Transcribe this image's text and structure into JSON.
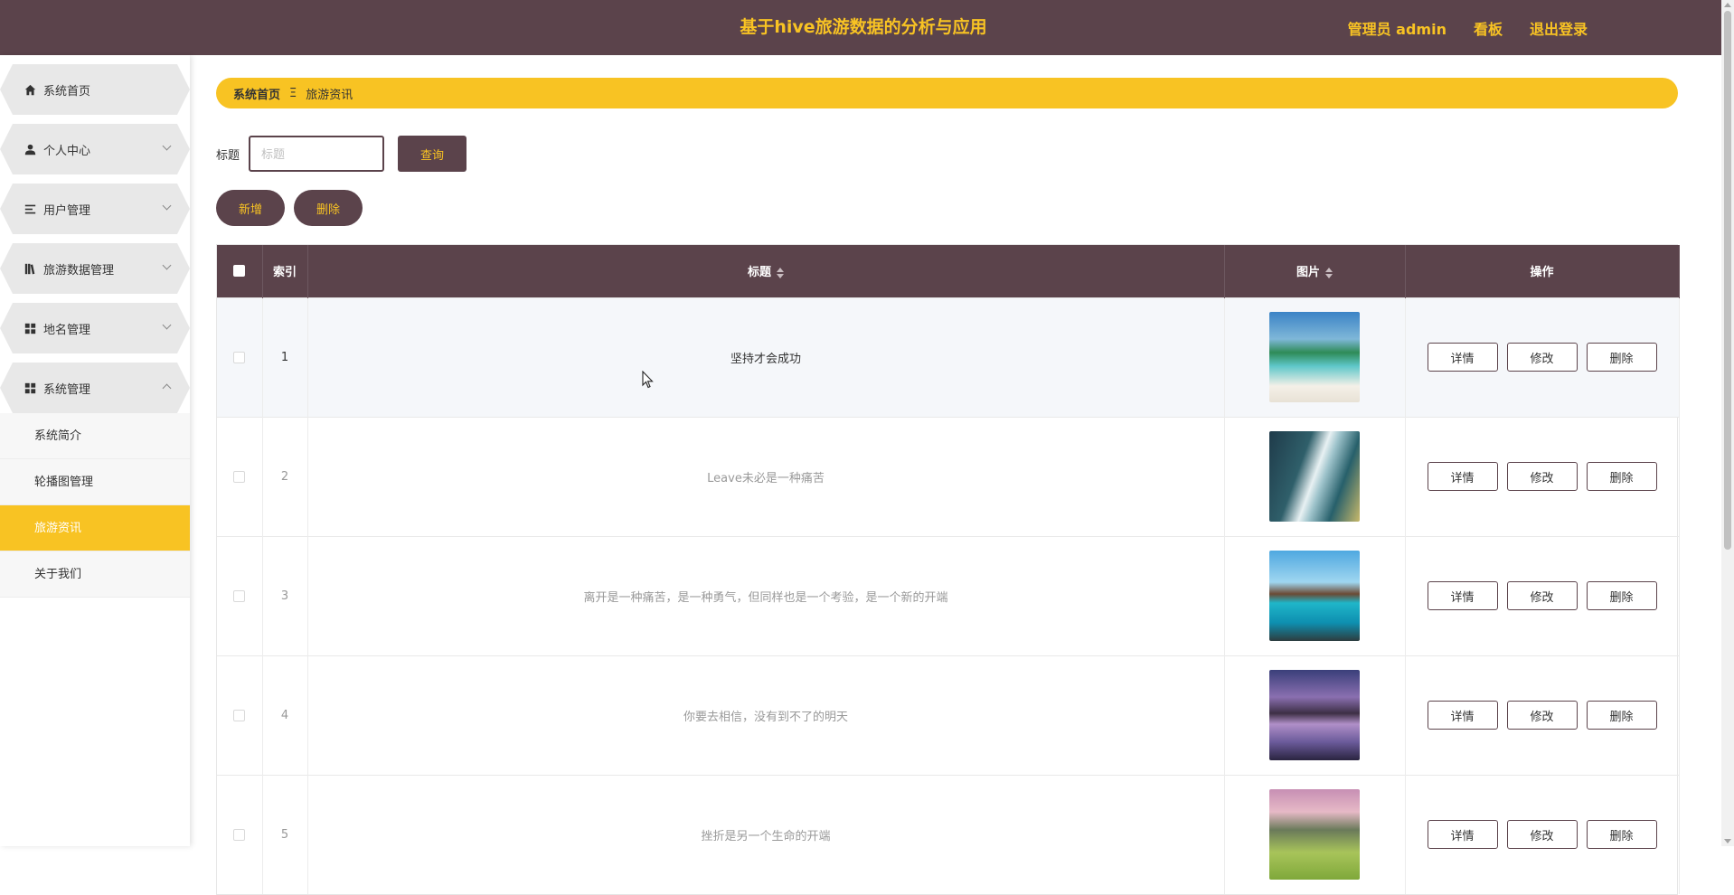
{
  "header": {
    "title": "基于hive旅游数据的分析与应用",
    "user": "管理员 admin",
    "board": "看板",
    "logout": "退出登录"
  },
  "sidebar": {
    "items": [
      {
        "label": "系统首页",
        "icon": "home-icon"
      },
      {
        "label": "个人中心",
        "icon": "user-icon"
      },
      {
        "label": "用户管理",
        "icon": "list-icon"
      },
      {
        "label": "旅游数据管理",
        "icon": "book-icon"
      },
      {
        "label": "地名管理",
        "icon": "grid-icon"
      },
      {
        "label": "系统管理",
        "icon": "grid-icon"
      }
    ],
    "submenu": [
      {
        "label": "系统简介"
      },
      {
        "label": "轮播图管理"
      },
      {
        "label": "旅游资讯"
      },
      {
        "label": "关于我们"
      }
    ]
  },
  "breadcrumb": {
    "home": "系统首页",
    "sep": "Ξ",
    "current": "旅游资讯"
  },
  "search": {
    "label": "标题",
    "placeholder": "标题",
    "query_label": "查询"
  },
  "actions": {
    "add_label": "新增",
    "delete_label": "删除"
  },
  "table": {
    "headers": [
      "索引",
      "标题",
      "图片",
      "操作"
    ],
    "row_buttons": {
      "detail": "详情",
      "edit": "修改",
      "delete": "删除"
    },
    "rows": [
      {
        "index": "1",
        "title": "坚持才会成功"
      },
      {
        "index": "2",
        "title": "Leave未必是一种痛苦"
      },
      {
        "index": "3",
        "title": "离开是一种痛苦，是一种勇气，但同样也是一个考验，是一个新的开端"
      },
      {
        "index": "4",
        "title": "你要去相信，没有到不了的明天"
      },
      {
        "index": "5",
        "title": "挫折是另一个生命的开端"
      }
    ]
  },
  "colors": {
    "primary": "#5b434b",
    "accent": "#f8c323"
  }
}
